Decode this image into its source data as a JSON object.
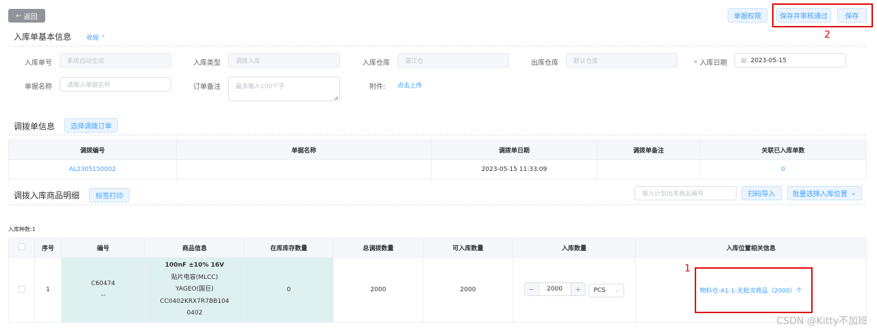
{
  "header": {
    "back_label": "返回",
    "back_icon": "arrow-left-icon",
    "doc_perm_label": "单据权限",
    "save_approve_label": "保存并审核通过",
    "save_label": "保存"
  },
  "basic": {
    "title": "入库单基本信息",
    "collapse_label": "收缩",
    "fields": {
      "order_no": {
        "label": "入库单号",
        "placeholder": "系统自动生成"
      },
      "type": {
        "label": "入库类型",
        "placeholder": "调拨入库"
      },
      "warehouse": {
        "label": "入库仓库",
        "placeholder": "湛江仓"
      },
      "out_warehouse": {
        "label": "出库仓库",
        "placeholder": "默认仓库"
      },
      "date": {
        "required_mark": "*",
        "label": "入库日期",
        "value": "2023-05-15"
      },
      "doc_name": {
        "label": "单据名称",
        "placeholder": "请输入单据名称"
      },
      "remark": {
        "label": "订单备注",
        "placeholder": "最多输入100个字"
      },
      "attachment": {
        "label": "附件:",
        "link": "点击上传"
      }
    }
  },
  "transfer": {
    "title": "调拨单信息",
    "select_button": "选择调拨订单",
    "columns": [
      "调拨编号",
      "单据名称",
      "调拨单日期",
      "调拨单备注",
      "关联已入库单数"
    ],
    "rows": [
      {
        "code": "AL2305150002",
        "name": "",
        "date": "2023-05-15 11:33:09",
        "remark": "",
        "count": "0"
      }
    ]
  },
  "details": {
    "title": "调拨入库商品明细",
    "print_button": "标签打印",
    "search_placeholder": "输入计划出库商品编号",
    "scan_button": "扫码导入",
    "batch_button": "批量选择入库位置",
    "kinds_label": "入库种数:1",
    "columns": [
      "序号",
      "编号",
      "商品信息",
      "在库库存数量",
      "总调拨数量",
      "可入库数量",
      "入库数量",
      "入库位置相关信息"
    ],
    "rows": [
      {
        "index": "1",
        "code": "C60474",
        "code_sub": "--",
        "info": [
          "100nF ±10% 16V",
          "贴片电容(MLCC)",
          "YAGEO(国巨)",
          "CC0402KRX7R7BB104",
          "0402"
        ],
        "stock": "0",
        "total": "2000",
        "available": "2000",
        "qty": "2000",
        "unit": "PCS",
        "location": "物料仓-A1-1-无批次商品（2000）个"
      }
    ]
  },
  "annotations": {
    "one": "1",
    "two": "2"
  },
  "watermark": "CSDN @Kitty不加班",
  "colors": {
    "primary": "#409eff",
    "annotation": "#e00000"
  }
}
